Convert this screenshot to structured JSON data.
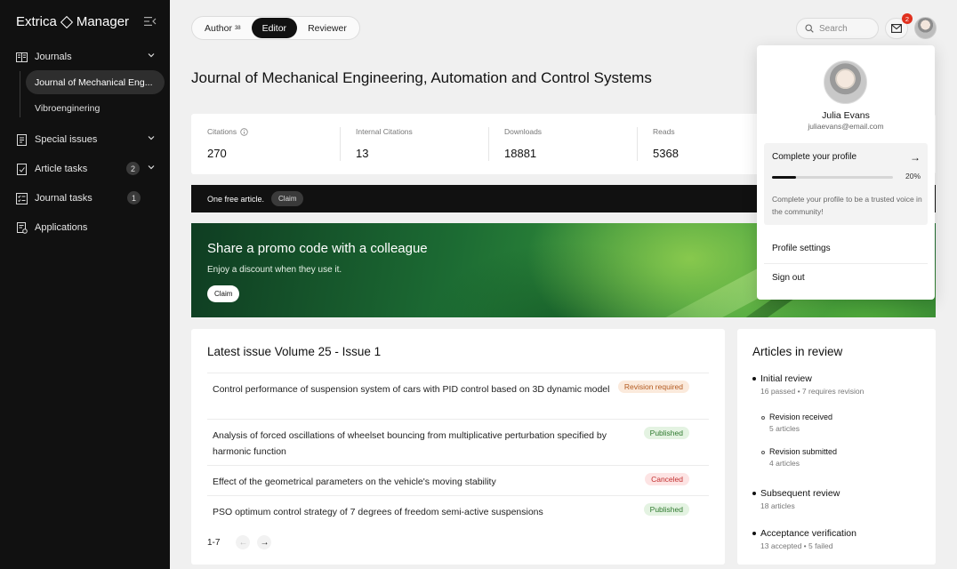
{
  "sidebar": {
    "brand_left": "Extrica",
    "brand_right": "Manager",
    "items": [
      {
        "label": "Journals"
      },
      {
        "label": "Special issues"
      },
      {
        "label": "Article tasks",
        "badge": "2"
      },
      {
        "label": "Journal tasks",
        "badge": "1"
      },
      {
        "label": "Applications"
      }
    ],
    "journals": [
      {
        "label": "Journal of Mechanical Eng..."
      },
      {
        "label": "Vibroenginering"
      }
    ]
  },
  "roles": {
    "author": "Author",
    "author_count": "38",
    "editor": "Editor",
    "reviewer": "Reviewer"
  },
  "header": {
    "search_placeholder": "Search",
    "mail_badge": "2"
  },
  "page_title": "Journal of Mechanical Engineering, Automation and Control Systems",
  "stats": [
    {
      "label": "Citations",
      "value": "270"
    },
    {
      "label": "Internal Citations",
      "value": "13"
    },
    {
      "label": "Downloads",
      "value": "18881"
    },
    {
      "label": "Reads",
      "value": "5368"
    }
  ],
  "free_article": {
    "text": "One free article.",
    "claim": "Claim"
  },
  "promo": {
    "title": "Share a promo code with a colleague",
    "subtitle": "Enjoy a discount when they use it.",
    "claim": "Claim"
  },
  "latest_issue": {
    "title": "Latest issue Volume 25 - Issue 1",
    "rows": [
      {
        "title": "Control performance of suspension system of cars with PID control based on 3D dynamic model",
        "status": "Revision required"
      },
      {
        "title": "Analysis of forced oscillations of wheelset bouncing from multiplicative perturbation specified by harmonic function",
        "status": "Published"
      },
      {
        "title": "Effect of the geometrical parameters on the vehicle's moving stability",
        "status": "Canceled"
      },
      {
        "title": "PSO optimum control strategy of 7 degrees of freedom semi-active suspensions",
        "status": "Published"
      }
    ],
    "range": "1-7",
    "prev": "←",
    "next": "→"
  },
  "review": {
    "title": "Articles in review",
    "initial": {
      "label": "Initial review",
      "sub": "16 passed • 7 requires revision"
    },
    "received": {
      "label": "Revision received",
      "sub": "5 articles"
    },
    "submitted": {
      "label": "Revision submitted",
      "sub": "4 articles"
    },
    "subsequent": {
      "label": "Subsequent review",
      "sub": "18 articles"
    },
    "acceptance": {
      "label": "Acceptance verification",
      "sub": "13 accepted • 5 failed"
    }
  },
  "profile_menu": {
    "name": "Julia Evans",
    "email": "juliaevans@email.com",
    "complete_title": "Complete your profile",
    "arrow": "→",
    "progress_percent": 20,
    "progress_label": "20%",
    "complete_desc": "Complete your profile to be a trusted voice in the community!",
    "settings": "Profile settings",
    "signout": "Sign out"
  },
  "colors": {
    "sidebar_bg": "#111111",
    "accent_dark": "#111111",
    "badge_red": "#e0301e",
    "status_revision": "#b35a1f",
    "status_published": "#2f7a2f",
    "status_canceled": "#c33131"
  }
}
